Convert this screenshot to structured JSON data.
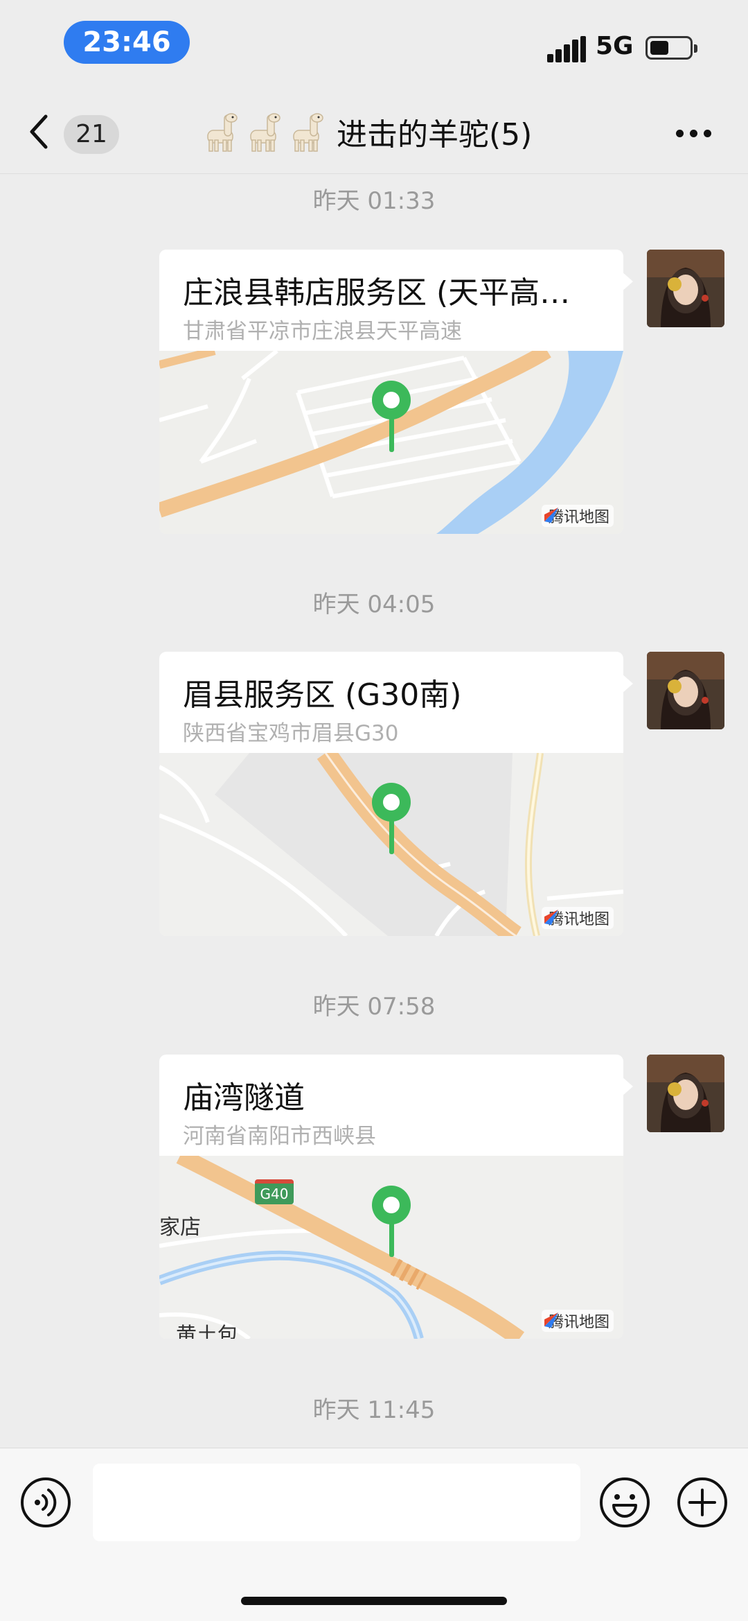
{
  "status_bar": {
    "time": "23:46",
    "network": "5G"
  },
  "nav": {
    "unread_count": "21",
    "title": "进击的羊驼(5)"
  },
  "messages": [
    {
      "timestamp": "昨天 01:33",
      "title": "庄浪县韩店服务区 (天平高…",
      "address": "甘肃省平凉市庄浪县天平高速",
      "map_provider": "腾讯地图"
    },
    {
      "timestamp": "昨天 04:05",
      "title": "眉县服务区 (G30南)",
      "address": "陕西省宝鸡市眉县G30",
      "map_provider": "腾讯地图",
      "map_labels": []
    },
    {
      "timestamp": "昨天 07:58",
      "title": "庙湾隧道",
      "address": "河南省南阳市西峡县",
      "map_provider": "腾讯地图",
      "map_labels": {
        "road_shield": "G40",
        "place1": "家店",
        "place2": "黄土包"
      }
    },
    {
      "timestamp": "昨天 11:45"
    }
  ],
  "colors": {
    "pin": "#3cb95a",
    "time_pill": "#2f7cf0",
    "road": "#f2c48e",
    "water": "#a9cff5"
  },
  "icons": [
    "back-icon",
    "llama-icon",
    "more-icon",
    "location-pin-icon",
    "tencent-map-logo-icon",
    "voice-icon",
    "emoji-icon",
    "plus-icon",
    "avatar"
  ]
}
